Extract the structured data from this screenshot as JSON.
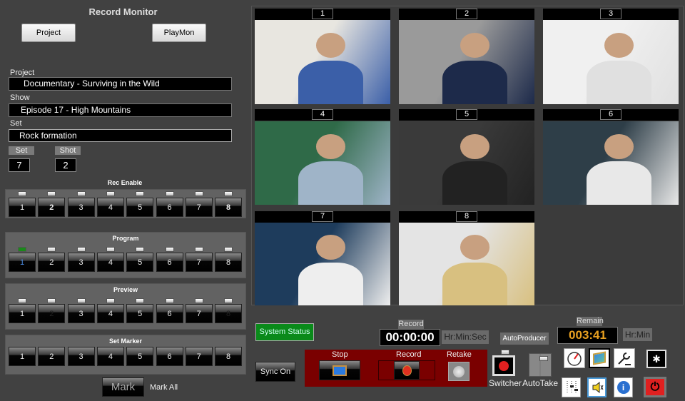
{
  "title": "Record Monitor",
  "buttons": {
    "project": "Project",
    "playmon": "PlayMon",
    "mark": "Mark",
    "mark_all": "Mark All",
    "system_status": "System Status",
    "sync_on": "Sync On"
  },
  "fields": {
    "project_label": "Project",
    "project_value": "Documentary - Surviving in the Wild",
    "show_label": "Show",
    "show_value": "Episode 17 - High Mountains",
    "set_label": "Set",
    "set_value": "Rock formation"
  },
  "counters": {
    "set_label": "Set",
    "set_value": "7",
    "shot_label": "Shot",
    "shot_value": "2"
  },
  "panels": {
    "rec_enable": "Rec Enable",
    "program": "Program",
    "preview": "Preview",
    "set_marker": "Set Marker"
  },
  "channels": [
    "1",
    "2",
    "3",
    "4",
    "5",
    "6",
    "7",
    "8"
  ],
  "program_active": 1,
  "preview_dimmed": [
    2,
    8
  ],
  "monitors": [
    {
      "label": "1",
      "colors": [
        "#e8e6e0",
        "#3b5fa8"
      ]
    },
    {
      "label": "2",
      "colors": [
        "#9a9a9a",
        "#1d2a4a"
      ]
    },
    {
      "label": "3",
      "colors": [
        "#f0f0f0",
        "#e0e0e0"
      ]
    },
    {
      "label": "4",
      "colors": [
        "#2f6a48",
        "#9fb4c8"
      ]
    },
    {
      "label": "5",
      "colors": [
        "#3a3a3a",
        "#222"
      ]
    },
    {
      "label": "6",
      "colors": [
        "#2e3e48",
        "#e8e8e8"
      ]
    },
    {
      "label": "7",
      "colors": [
        "#1e3c5c",
        "#eeeeee"
      ]
    },
    {
      "label": "8",
      "colors": [
        "#e4e4e4",
        "#d8c080"
      ]
    }
  ],
  "transport": {
    "stop": "Stop",
    "record": "Record",
    "retake": "Retake"
  },
  "record_timer": {
    "label": "Record",
    "value": "00:00:00",
    "unit": "Hr:Min:Sec"
  },
  "remain_timer": {
    "label": "Remain",
    "value": "003:41",
    "unit": "Hr:Min"
  },
  "autoproducer": {
    "label": "AutoProducer",
    "switcher": "Switcher",
    "autotake": "AutoTake"
  },
  "colors": {
    "status_green": "#0a8a1a",
    "transport_red": "#7a0000",
    "remain_orange": "#e8a020"
  }
}
